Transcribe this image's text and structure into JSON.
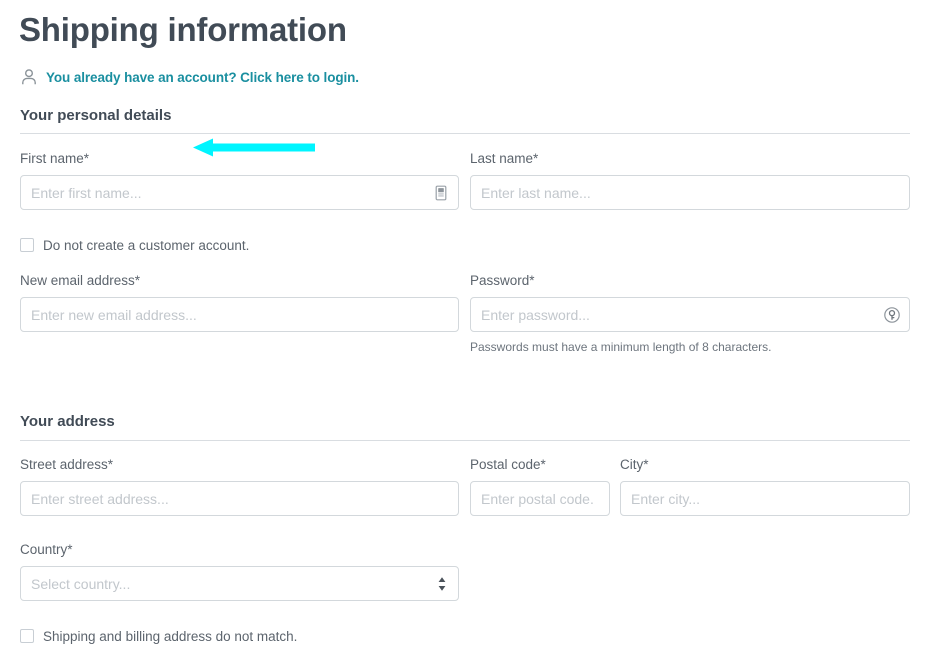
{
  "page": {
    "title": "Shipping information"
  },
  "login": {
    "icon": "user-icon",
    "text": "You already have an account? Click here to login."
  },
  "sections": [
    {
      "id": "personal",
      "title": "Your personal details"
    },
    {
      "id": "address",
      "title": "Your address"
    }
  ],
  "fields": {
    "first_name": {
      "label": "First name*",
      "placeholder": "Enter first name...",
      "value": "",
      "icon": "contact-card-autofill-icon"
    },
    "last_name": {
      "label": "Last name*",
      "placeholder": "Enter last name...",
      "value": ""
    },
    "new_email": {
      "label": "New email address*",
      "placeholder": "Enter new email address...",
      "value": ""
    },
    "password": {
      "label": "Password*",
      "placeholder": "Enter password...",
      "value": "",
      "icon": "key-generate-password-icon",
      "hint": "Passwords must have a minimum length of 8 characters."
    },
    "street_address": {
      "label": "Street address*",
      "placeholder": "Enter street address...",
      "value": ""
    },
    "postal_code": {
      "label": "Postal code*",
      "placeholder": "Enter postal code.",
      "value": ""
    },
    "city": {
      "label": "City*",
      "placeholder": "Enter city...",
      "value": ""
    },
    "country": {
      "label": "Country*",
      "placeholder": "Select country...",
      "value": "",
      "icon": "select-updown-chevron-icon"
    }
  },
  "checkboxes": {
    "no_account": {
      "label": "Do not create a customer account.",
      "checked": false
    },
    "billing_mismatch": {
      "label": "Shipping and billing address do not match.",
      "checked": false
    }
  },
  "annotation": {
    "type": "arrow-left",
    "color": "#00f5ff",
    "points_to": "first-name-label"
  },
  "colors": {
    "title": "#414b56",
    "link": "#1a8fa0",
    "label": "#5c646d",
    "placeholder": "#c2c7cc",
    "border": "#d3d8dc",
    "divider": "#d9dde1",
    "annotation": "#00f5ff"
  }
}
